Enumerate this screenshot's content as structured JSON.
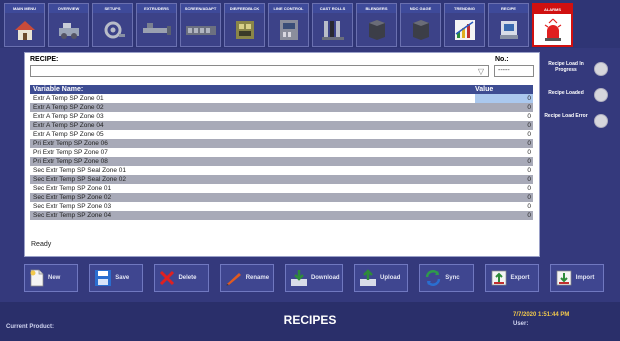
{
  "nav": {
    "tabs": [
      {
        "label": "MAIN MENU",
        "icon": "house-icon"
      },
      {
        "label": "OVERVIEW",
        "icon": "machine-overview-icon"
      },
      {
        "label": "SETUPS",
        "icon": "setups-icon"
      },
      {
        "label": "EXTRUDERS",
        "icon": "extruder-icon"
      },
      {
        "label": "SCREEN/ADAPT",
        "icon": "screen-adapter-icon"
      },
      {
        "label": "DIE/FEEDBLCK",
        "icon": "die-feedblock-icon"
      },
      {
        "label": "LINE CONTROL",
        "icon": "line-control-icon"
      },
      {
        "label": "CAST ROLLS",
        "icon": "cast-rolls-icon"
      },
      {
        "label": "BLENDERS",
        "icon": "blender-icon"
      },
      {
        "label": "NDC GAGE",
        "icon": "gage-icon"
      },
      {
        "label": "TRENDING",
        "icon": "trending-chart-icon"
      },
      {
        "label": "RECIPE",
        "icon": "recipe-icon"
      },
      {
        "label": "ALARMS",
        "icon": "alarm-light-icon"
      }
    ],
    "selected_index": 12
  },
  "recipe": {
    "label": "RECIPE:",
    "selected_value": "",
    "no_label": "No.:",
    "no_value": "-----"
  },
  "grid": {
    "col_name": "Variable Name:",
    "col_value": "Value",
    "rows": [
      {
        "name": "Extr A Temp SP Zone 01",
        "value": "0"
      },
      {
        "name": "Extr A Temp SP Zone 02",
        "value": "0"
      },
      {
        "name": "Extr A Temp SP Zone 03",
        "value": "0"
      },
      {
        "name": "Extr A Temp SP Zone 04",
        "value": "0"
      },
      {
        "name": "Extr A Temp SP Zone 05",
        "value": "0"
      },
      {
        "name": "Pri Extr Temp SP Zone 06",
        "value": "0"
      },
      {
        "name": "Pri Extr Temp SP Zone 07",
        "value": "0"
      },
      {
        "name": "Pri Extr Temp SP Zone 08",
        "value": "0"
      },
      {
        "name": "Sec Extr Temp SP Seal Zone 01",
        "value": "0"
      },
      {
        "name": "Sec Extr Temp SP Seal Zone 02",
        "value": "0"
      },
      {
        "name": "Sec Extr Temp SP Zone 01",
        "value": "0"
      },
      {
        "name": "Sec Extr Temp SP Zone 02",
        "value": "0"
      },
      {
        "name": "Sec Extr Temp SP Zone 03",
        "value": "0"
      },
      {
        "name": "Sec Extr Temp SP Zone 04",
        "value": "0"
      }
    ]
  },
  "status": "Ready",
  "indicators": [
    {
      "label": "Recipe Load In Progress"
    },
    {
      "label": "Recipe Loaded"
    },
    {
      "label": "Recipe Load Error"
    }
  ],
  "toolbar": {
    "new": "New",
    "save": "Save",
    "delete": "Delete",
    "rename": "Rename",
    "download": "Download",
    "upload": "Upload",
    "sync": "Sync",
    "export": "Export",
    "import": "Import"
  },
  "footer": {
    "current_product": "Current Product:",
    "title": "RECIPES",
    "datetime": "7/7/2020 1:51:44 PM",
    "user": "User:"
  },
  "colors": {
    "background": "#34397c",
    "header_row": "#3d4c92",
    "alarm_red": "#d01010",
    "date_yellow": "#f2c94c"
  }
}
